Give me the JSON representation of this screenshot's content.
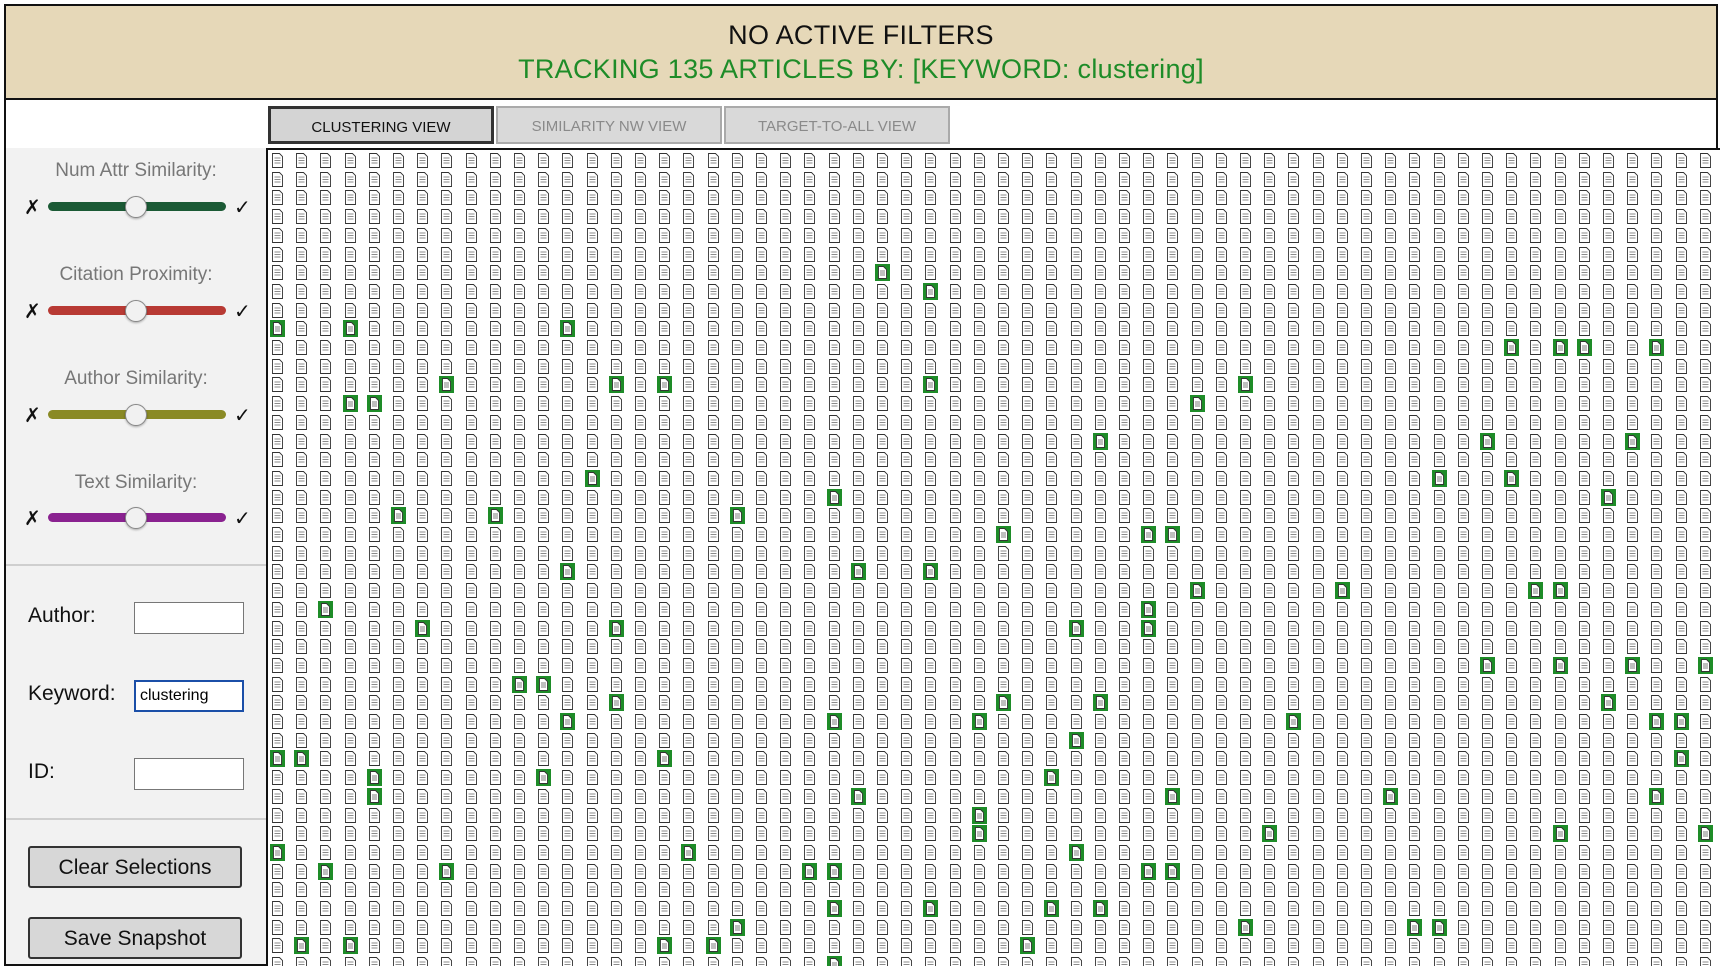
{
  "header": {
    "title": "NO ACTIVE FILTERS",
    "subtitle": "TRACKING 135 ARTICLES BY: [KEYWORD: clustering]"
  },
  "tabs": [
    {
      "label": "CLUSTERING VIEW",
      "active": true
    },
    {
      "label": "SIMILARITY NW VIEW",
      "active": false
    },
    {
      "label": "TARGET-TO-ALL VIEW",
      "active": false
    }
  ],
  "sliders": [
    {
      "label": "Num Attr Similarity:",
      "color": "#1b5a35",
      "value": 0.5,
      "min_symbol": "✗",
      "max_symbol": "✓"
    },
    {
      "label": "Citation Proximity:",
      "color": "#b83a34",
      "value": 0.5,
      "min_symbol": "✗",
      "max_symbol": "✓"
    },
    {
      "label": "Author Similarity:",
      "color": "#8a8a25",
      "value": 0.5,
      "min_symbol": "✗",
      "max_symbol": "✓"
    },
    {
      "label": "Text Similarity:",
      "color": "#8a2290",
      "value": 0.5,
      "min_symbol": "✗",
      "max_symbol": "✓"
    }
  ],
  "fields": [
    {
      "label": "Author:",
      "value": ""
    },
    {
      "label": "Keyword:",
      "value": "clustering"
    },
    {
      "label": "ID:",
      "value": ""
    }
  ],
  "buttons": {
    "clear": "Clear Selections",
    "save": "Save Snapshot"
  },
  "grid": {
    "tile_icon": "document-icon",
    "highlight_color": "#1e8c28",
    "columns": 60,
    "rows": 45,
    "highlighted": [
      [
        6,
        25
      ],
      [
        7,
        27
      ],
      [
        9,
        0
      ],
      [
        9,
        3
      ],
      [
        9,
        12
      ],
      [
        10,
        51
      ],
      [
        10,
        53
      ],
      [
        10,
        54
      ],
      [
        10,
        57
      ],
      [
        12,
        7
      ],
      [
        12,
        14
      ],
      [
        12,
        16
      ],
      [
        12,
        27
      ],
      [
        12,
        40
      ],
      [
        13,
        3
      ],
      [
        13,
        4
      ],
      [
        13,
        38
      ],
      [
        15,
        34
      ],
      [
        15,
        50
      ],
      [
        15,
        56
      ],
      [
        17,
        13
      ],
      [
        17,
        48
      ],
      [
        17,
        51
      ],
      [
        18,
        23
      ],
      [
        18,
        55
      ],
      [
        19,
        5
      ],
      [
        19,
        9
      ],
      [
        19,
        19
      ],
      [
        20,
        30
      ],
      [
        20,
        36
      ],
      [
        20,
        37
      ],
      [
        22,
        12
      ],
      [
        22,
        24
      ],
      [
        22,
        27
      ],
      [
        23,
        38
      ],
      [
        23,
        44
      ],
      [
        23,
        52
      ],
      [
        23,
        53
      ],
      [
        24,
        2
      ],
      [
        24,
        36
      ],
      [
        25,
        6
      ],
      [
        25,
        14
      ],
      [
        25,
        33
      ],
      [
        25,
        36
      ],
      [
        27,
        50
      ],
      [
        27,
        53
      ],
      [
        27,
        56
      ],
      [
        27,
        59
      ],
      [
        28,
        10
      ],
      [
        28,
        11
      ],
      [
        29,
        14
      ],
      [
        29,
        30
      ],
      [
        29,
        34
      ],
      [
        29,
        55
      ],
      [
        30,
        12
      ],
      [
        30,
        23
      ],
      [
        30,
        29
      ],
      [
        30,
        42
      ],
      [
        30,
        57
      ],
      [
        30,
        58
      ],
      [
        31,
        33
      ],
      [
        32,
        0
      ],
      [
        32,
        1
      ],
      [
        32,
        16
      ],
      [
        32,
        58
      ],
      [
        33,
        4
      ],
      [
        33,
        11
      ],
      [
        33,
        32
      ],
      [
        34,
        4
      ],
      [
        34,
        24
      ],
      [
        34,
        37
      ],
      [
        34,
        46
      ],
      [
        34,
        57
      ],
      [
        35,
        29
      ],
      [
        36,
        29
      ],
      [
        36,
        41
      ],
      [
        36,
        53
      ],
      [
        36,
        59
      ],
      [
        37,
        0
      ],
      [
        37,
        17
      ],
      [
        37,
        33
      ],
      [
        38,
        2
      ],
      [
        38,
        7
      ],
      [
        38,
        22
      ],
      [
        38,
        23
      ],
      [
        38,
        36
      ],
      [
        38,
        37
      ],
      [
        40,
        23
      ],
      [
        40,
        27
      ],
      [
        40,
        32
      ],
      [
        40,
        34
      ],
      [
        41,
        19
      ],
      [
        41,
        40
      ],
      [
        41,
        47
      ],
      [
        41,
        48
      ],
      [
        42,
        1
      ],
      [
        42,
        3
      ],
      [
        42,
        16
      ],
      [
        42,
        18
      ],
      [
        42,
        31
      ],
      [
        43,
        23
      ]
    ]
  }
}
